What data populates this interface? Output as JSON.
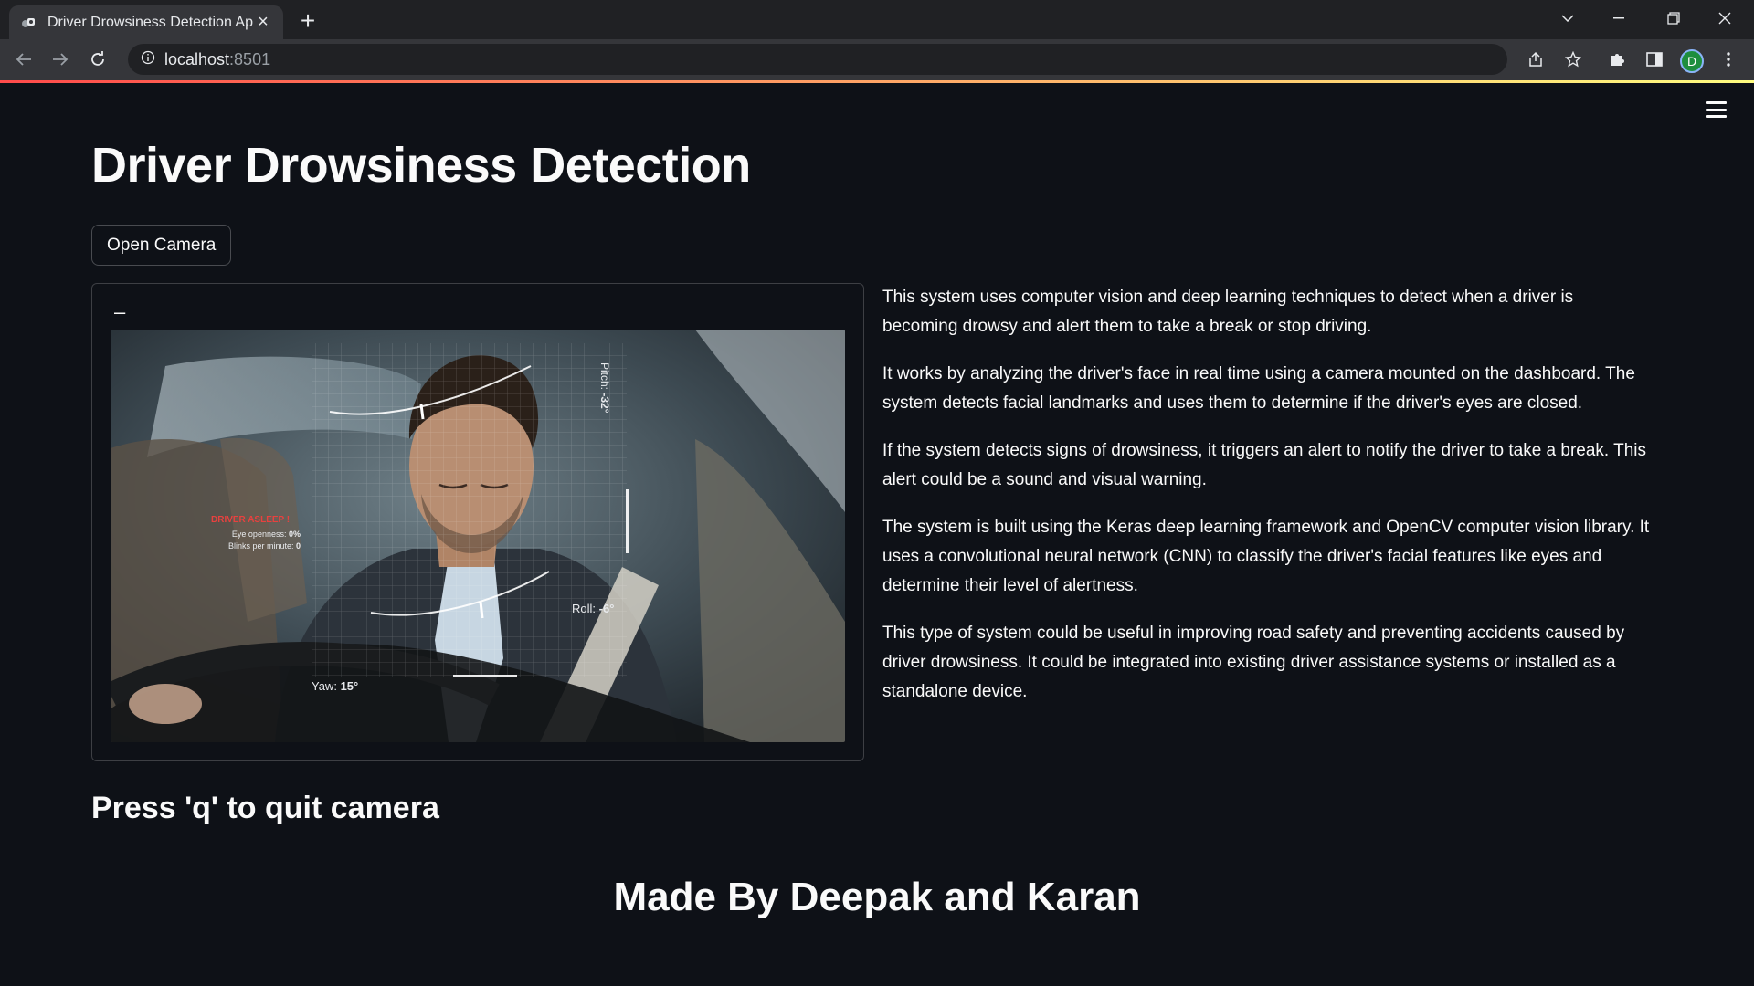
{
  "browser": {
    "tab_title": "Driver Drowsiness Detection App",
    "url_host": "localhost",
    "url_port": ":8501",
    "avatar_letter": "D"
  },
  "app": {
    "title": "Driver Drowsiness Detection",
    "open_camera_label": "Open Camera",
    "camera_dash": "–",
    "camera_frame": {
      "alert_label": "DRIVER ASLEEP !",
      "eye_openness_label": "Eye openness:",
      "eye_openness_value": "0%",
      "blinks_label": "Blinks per minute:",
      "blinks_value": "0",
      "pitch_label": "Pitch:",
      "pitch_value": "-32°",
      "roll_label": "Roll:",
      "roll_value": "-6°",
      "yaw_label": "Yaw:",
      "yaw_value": "15°"
    },
    "paragraphs": [
      "This system uses computer vision and deep learning techniques to detect when a driver is becoming drowsy and alert them to take a break or stop driving.",
      "It works by analyzing the driver's face in real time using a camera mounted on the dashboard. The system detects facial landmarks and uses them to determine if the driver's eyes are closed.",
      "If the system detects signs of drowsiness, it triggers an alert to notify the driver to take a break. This alert could be a sound and visual warning.",
      "The system is built using the Keras deep learning framework and OpenCV computer vision library. It uses a convolutional neural network (CNN) to classify the driver's facial features like eyes and determine their level of alertness.",
      "This type of system could be useful in improving road safety and preventing accidents caused by driver drowsiness. It could be integrated into existing driver assistance systems or installed as a standalone device."
    ],
    "quit_note": "Press 'q' to quit camera",
    "footer": "Made By Deepak and Karan"
  },
  "colors": {
    "background": "#0e1117",
    "text": "#fafafa",
    "alert": "#e8413f",
    "header_gradient_start": "#ff4b4b",
    "header_gradient_end": "#fffd80"
  }
}
